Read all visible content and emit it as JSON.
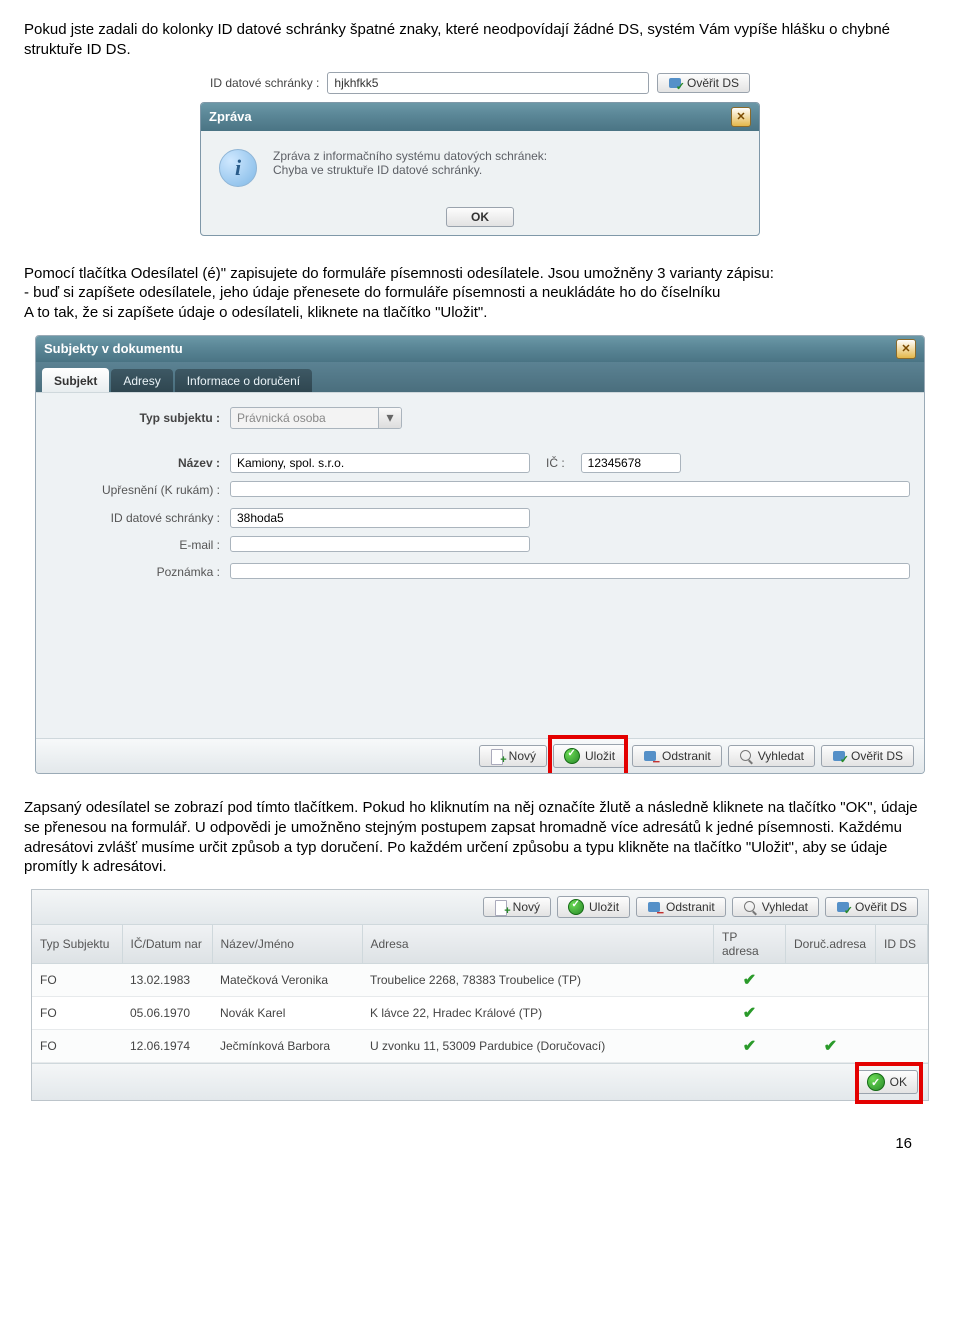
{
  "para1": "Pokud jste zadali do kolonky ID datové schránky špatné znaky, které neodpovídají žádné DS, systém Vám vypíše hlášku o chybné struktuře ID DS.",
  "shot1": {
    "idLabel": "ID datové schránky :",
    "idValue": "hjkhfkk5",
    "verifyBtn": "Ověřit DS",
    "head": "Zpráva",
    "msg": "Zpráva z informačního systému datových schránek:\nChyba ve struktuře ID datové schránky.",
    "ok": "OK"
  },
  "para2": "Pomocí tlačítka Odesílatel (é)\" zapisujete do formuláře písemnosti odesílatele. Jsou umožněny 3 varianty zápisu:",
  "para3": "- buď si zapíšete odesílatele, jeho údaje přenesete do formuláře písemnosti a neukládáte ho do číselníku",
  "para4": "A to tak, že si zapíšete údaje o odesílateli, kliknete na tlačítko \"Uložit\".",
  "shot2": {
    "head": "Subjekty v dokumentu",
    "tabs": [
      "Subjekt",
      "Adresy",
      "Informace o doručení"
    ],
    "labels": {
      "typ": "Typ subjektu :",
      "nazev": "Název :",
      "ic": "IČ :",
      "upresneni": "Upřesnění (K rukám) :",
      "idds": "ID datové schránky :",
      "email": "E-mail :",
      "poznamka": "Poznámka :"
    },
    "vals": {
      "typ": "Právnická osoba",
      "nazev": "Kamiony, spol. s.r.o.",
      "ic": "12345678",
      "idds": "38hoda5"
    },
    "buttons": {
      "novy": "Nový",
      "ulozit": "Uložit",
      "odstranit": "Odstranit",
      "vyhledat": "Vyhledat",
      "overit": "Ověřit DS"
    }
  },
  "para5": "Zapsaný odesílatel se zobrazí pod tímto tlačítkem. Pokud ho kliknutím na něj označíte žlutě a následně kliknete na tlačítko \"OK\", údaje se přenesou na formulář. U odpovědi je umožněno stejným postupem zapsat hromadně více adresátů k jedné písemnosti. Každému adresátovi zvlášť musíme určit způsob a typ doručení. Po každém určení způsobu a typu klikněte na tlačítko \"Uložit\", aby se údaje promítly k adresátovi.",
  "shot3": {
    "buttons": {
      "novy": "Nový",
      "ulozit": "Uložit",
      "odstranit": "Odstranit",
      "vyhledat": "Vyhledat",
      "overit": "Ověřit DS"
    },
    "cols": [
      "Typ Subjektu",
      "IČ/Datum nar",
      "Název/Jméno",
      "Adresa",
      "TP adresa",
      "Doruč.adresa",
      "ID DS"
    ],
    "rows": [
      {
        "typ": "FO",
        "dat": "13.02.1983",
        "jmeno": "Matečková Veronika",
        "adresa": "Troubelice 2268, 78383 Troubelice (TP)",
        "tp": true,
        "doruc": false,
        "idds": false
      },
      {
        "typ": "FO",
        "dat": "05.06.1970",
        "jmeno": "Novák Karel",
        "adresa": "K lávce 22, Hradec Králové (TP)",
        "tp": true,
        "doruc": false,
        "idds": false
      },
      {
        "typ": "FO",
        "dat": "12.06.1974",
        "jmeno": "Ječmínková Barbora",
        "adresa": "U zvonku 11, 53009 Pardubice (Doručovací)",
        "tp": true,
        "doruc": true,
        "idds": false
      }
    ],
    "okBtn": "OK"
  },
  "pageNumber": "16"
}
